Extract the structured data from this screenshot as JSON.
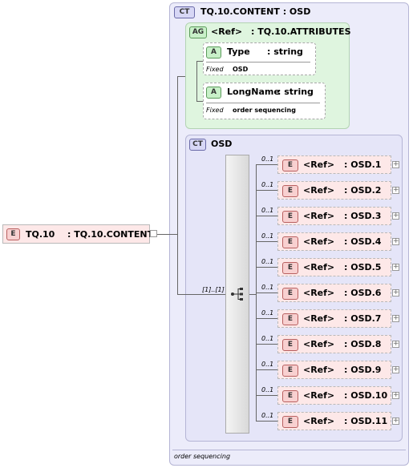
{
  "root": {
    "badge": "E",
    "name": "TQ.10",
    "type": ": TQ.10.CONTENT"
  },
  "complex_type": {
    "badge": "CT",
    "title": "TQ.10.CONTENT : OSD",
    "footer": "order sequencing"
  },
  "attr_group": {
    "badge": "AG",
    "ref": "<Ref>",
    "type": ": TQ.10.ATTRIBUTES",
    "attributes": [
      {
        "badge": "A",
        "name": "Type",
        "type": ": string",
        "fixed_label": "Fixed",
        "fixed_value": "OSD"
      },
      {
        "badge": "A",
        "name": "LongName",
        "type": ": string",
        "fixed_label": "Fixed",
        "fixed_value": "order sequencing"
      }
    ]
  },
  "inner_ct": {
    "badge": "CT",
    "title": "OSD"
  },
  "sequence": {
    "occurrence": "[1]..[1]"
  },
  "elements": [
    {
      "badge": "E",
      "ref": "<Ref>",
      "type": ": OSD.1",
      "occurrence": "0..1"
    },
    {
      "badge": "E",
      "ref": "<Ref>",
      "type": ": OSD.2",
      "occurrence": "0..1"
    },
    {
      "badge": "E",
      "ref": "<Ref>",
      "type": ": OSD.3",
      "occurrence": "0..1"
    },
    {
      "badge": "E",
      "ref": "<Ref>",
      "type": ": OSD.4",
      "occurrence": "0..1"
    },
    {
      "badge": "E",
      "ref": "<Ref>",
      "type": ": OSD.5",
      "occurrence": "0..1"
    },
    {
      "badge": "E",
      "ref": "<Ref>",
      "type": ": OSD.6",
      "occurrence": "0..1"
    },
    {
      "badge": "E",
      "ref": "<Ref>",
      "type": ": OSD.7",
      "occurrence": "0..1"
    },
    {
      "badge": "E",
      "ref": "<Ref>",
      "type": ": OSD.8",
      "occurrence": "0..1"
    },
    {
      "badge": "E",
      "ref": "<Ref>",
      "type": ": OSD.9",
      "occurrence": "0..1"
    },
    {
      "badge": "E",
      "ref": "<Ref>",
      "type": ": OSD.10",
      "occurrence": "0..1"
    },
    {
      "badge": "E",
      "ref": "<Ref>",
      "type": ": OSD.11",
      "occurrence": "0..1"
    }
  ]
}
